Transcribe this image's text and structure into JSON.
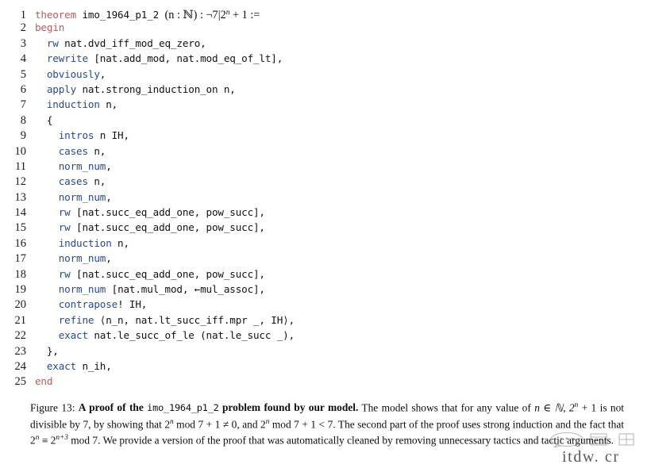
{
  "figure": {
    "number": "Figure 13:",
    "title_bold_1": "A proof of the ",
    "title_mono": "imo_1964_p1_2",
    "title_bold_2": " problem found by our model.",
    "body_1": " The model shows that for any value of ",
    "math_1": "n ∈ ℕ, 2",
    "math_1_sup": "n",
    "math_1_rest": " + 1",
    "body_2": " is not divisible by 7, by showing that ",
    "math_2": "2",
    "math_2_sup": "n",
    "math_2_rest": " mod 7 + 1 ≠ 0",
    "body_3": ", and ",
    "math_3": "2",
    "math_3_sup": "n",
    "math_3_rest": " mod 7 + 1 < 7",
    "body_4": ". The second part of the proof uses strong induction and the fact that ",
    "math_4": "2",
    "math_4_sup": "n",
    "math_4_mid": " ≡ 2",
    "math_4_sup2": "n+3",
    "math_4_rest": "  mod 7",
    "body_5": ". We provide a version of the proof that was automatically cleaned by removing unnecessary tactics and tactic arguments."
  },
  "watermark": {
    "text": "itdw. cr",
    "icon": "chat-bubble-icon"
  },
  "colors": {
    "keyword_declaration": "#b0605f",
    "keyword_tactic": "#2b4a8b",
    "code_plain": "#111111",
    "background": "#ffffff"
  },
  "code": {
    "language": "lean",
    "line_numbers": [
      1,
      2,
      3,
      4,
      5,
      6,
      7,
      8,
      9,
      10,
      11,
      12,
      13,
      14,
      15,
      16,
      17,
      18,
      19,
      20,
      21,
      22,
      23,
      24,
      25
    ],
    "lines": [
      {
        "n": 1,
        "indent": 0,
        "kind": "theorem-signature",
        "parts": [
          {
            "t": "theorem",
            "c": "kw-decl"
          },
          {
            "t": " imo_1964_p1_2 ",
            "c": "plain"
          },
          {
            "t": "(n : ℕ) : ¬7|2",
            "c": "math",
            "sup": "n"
          },
          {
            "t": " + 1 :=",
            "c": "math-tail"
          }
        ],
        "text": "theorem imo_1964_p1_2 (n : ℕ) : ¬7|2ⁿ + 1 :="
      },
      {
        "n": 2,
        "indent": 0,
        "parts": [
          {
            "t": "begin",
            "c": "kw-decl"
          }
        ],
        "text": "begin"
      },
      {
        "n": 3,
        "indent": 2,
        "parts": [
          {
            "t": "rw",
            "c": "kw-tac"
          },
          {
            "t": " nat.dvd_iff_mod_eq_zero,",
            "c": "plain"
          }
        ],
        "text": "rw nat.dvd_iff_mod_eq_zero,"
      },
      {
        "n": 4,
        "indent": 2,
        "parts": [
          {
            "t": "rewrite",
            "c": "kw-tac"
          },
          {
            "t": " [nat.add_mod, nat.mod_eq_of_lt],",
            "c": "plain"
          }
        ],
        "text": "rewrite [nat.add_mod, nat.mod_eq_of_lt],"
      },
      {
        "n": 5,
        "indent": 2,
        "parts": [
          {
            "t": "obviously",
            "c": "kw-tac"
          },
          {
            "t": ",",
            "c": "plain"
          }
        ],
        "text": "obviously,"
      },
      {
        "n": 6,
        "indent": 2,
        "parts": [
          {
            "t": "apply",
            "c": "kw-tac"
          },
          {
            "t": " nat.strong_induction_on n,",
            "c": "plain"
          }
        ],
        "text": "apply nat.strong_induction_on n,"
      },
      {
        "n": 7,
        "indent": 2,
        "parts": [
          {
            "t": "induction",
            "c": "kw-tac"
          },
          {
            "t": " n,",
            "c": "plain"
          }
        ],
        "text": "induction n,"
      },
      {
        "n": 8,
        "indent": 2,
        "parts": [
          {
            "t": "{",
            "c": "plain"
          }
        ],
        "text": "{"
      },
      {
        "n": 9,
        "indent": 4,
        "parts": [
          {
            "t": "intros",
            "c": "kw-tac"
          },
          {
            "t": " n IH,",
            "c": "plain"
          }
        ],
        "text": "intros n IH,"
      },
      {
        "n": 10,
        "indent": 4,
        "parts": [
          {
            "t": "cases",
            "c": "kw-tac"
          },
          {
            "t": " n,",
            "c": "plain"
          }
        ],
        "text": "cases n,"
      },
      {
        "n": 11,
        "indent": 4,
        "parts": [
          {
            "t": "norm_num",
            "c": "kw-tac"
          },
          {
            "t": ",",
            "c": "plain"
          }
        ],
        "text": "norm_num,"
      },
      {
        "n": 12,
        "indent": 4,
        "parts": [
          {
            "t": "cases",
            "c": "kw-tac"
          },
          {
            "t": " n,",
            "c": "plain"
          }
        ],
        "text": "cases n,"
      },
      {
        "n": 13,
        "indent": 4,
        "parts": [
          {
            "t": "norm_num",
            "c": "kw-tac"
          },
          {
            "t": ",",
            "c": "plain"
          }
        ],
        "text": "norm_num,"
      },
      {
        "n": 14,
        "indent": 4,
        "parts": [
          {
            "t": "rw",
            "c": "kw-tac"
          },
          {
            "t": " [nat.succ_eq_add_one, pow_succ],",
            "c": "plain"
          }
        ],
        "text": "rw [nat.succ_eq_add_one, pow_succ],"
      },
      {
        "n": 15,
        "indent": 4,
        "parts": [
          {
            "t": "rw",
            "c": "kw-tac"
          },
          {
            "t": " [nat.succ_eq_add_one, pow_succ],",
            "c": "plain"
          }
        ],
        "text": "rw [nat.succ_eq_add_one, pow_succ],"
      },
      {
        "n": 16,
        "indent": 4,
        "parts": [
          {
            "t": "induction",
            "c": "kw-tac"
          },
          {
            "t": " n,",
            "c": "plain"
          }
        ],
        "text": "induction n,"
      },
      {
        "n": 17,
        "indent": 4,
        "parts": [
          {
            "t": "norm_num",
            "c": "kw-tac"
          },
          {
            "t": ",",
            "c": "plain"
          }
        ],
        "text": "norm_num,"
      },
      {
        "n": 18,
        "indent": 4,
        "parts": [
          {
            "t": "rw",
            "c": "kw-tac"
          },
          {
            "t": " [nat.succ_eq_add_one, pow_succ],",
            "c": "plain"
          }
        ],
        "text": "rw [nat.succ_eq_add_one, pow_succ],"
      },
      {
        "n": 19,
        "indent": 4,
        "parts": [
          {
            "t": "norm_num",
            "c": "kw-tac"
          },
          {
            "t": " [nat.mul_mod, ←mul_assoc],",
            "c": "plain"
          }
        ],
        "text": "norm_num [nat.mul_mod, ←mul_assoc],"
      },
      {
        "n": 20,
        "indent": 4,
        "parts": [
          {
            "t": "contrapose",
            "c": "kw-tac"
          },
          {
            "t": "! IH,",
            "c": "plain"
          }
        ],
        "text": "contrapose! IH,"
      },
      {
        "n": 21,
        "indent": 4,
        "parts": [
          {
            "t": "refine",
            "c": "kw-tac"
          },
          {
            "t": " ⟨n_n, nat.lt_succ_iff.mpr _, IH⟩,",
            "c": "plain"
          }
        ],
        "text": "refine ⟨n_n, nat.lt_succ_iff.mpr _, IH⟩,"
      },
      {
        "n": 22,
        "indent": 4,
        "parts": [
          {
            "t": "exact",
            "c": "kw-tac"
          },
          {
            "t": " nat.le_succ_of_le (nat.le_succ _),",
            "c": "plain"
          }
        ],
        "text": "exact nat.le_succ_of_le (nat.le_succ _),"
      },
      {
        "n": 23,
        "indent": 2,
        "parts": [
          {
            "t": "},",
            "c": "plain"
          }
        ],
        "text": "},"
      },
      {
        "n": 24,
        "indent": 2,
        "parts": [
          {
            "t": "exact",
            "c": "kw-tac"
          },
          {
            "t": " n_ih,",
            "c": "plain"
          }
        ],
        "text": "exact n_ih,"
      },
      {
        "n": 25,
        "indent": 0,
        "parts": [
          {
            "t": "end",
            "c": "kw-decl"
          }
        ],
        "text": "end"
      }
    ]
  }
}
